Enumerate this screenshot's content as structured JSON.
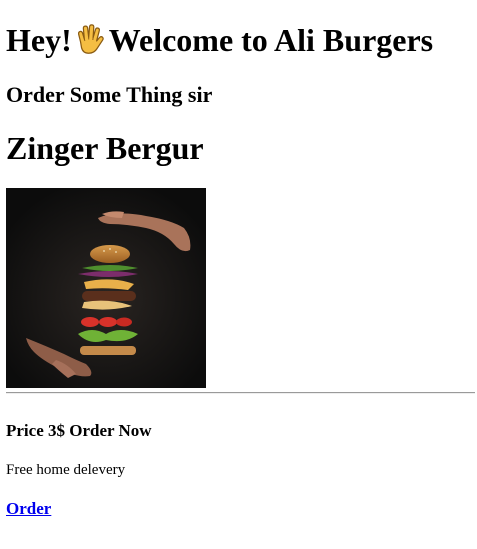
{
  "header": {
    "greeting": "Hey!",
    "welcome": "Welcome to Ali Burgers",
    "hand_icon": "raised-hand-emoji"
  },
  "subtitle": "Order Some Thing sir",
  "product": {
    "name": "Zinger Bergur",
    "image_icon": "burger-photo",
    "price_line": "Price 3$ Order Now",
    "delivery_note": "Free home delevery",
    "order_link": "Order"
  },
  "colors": {
    "link": "#0000ee",
    "image_background": "#121212",
    "divider": "#9a9a9a"
  }
}
